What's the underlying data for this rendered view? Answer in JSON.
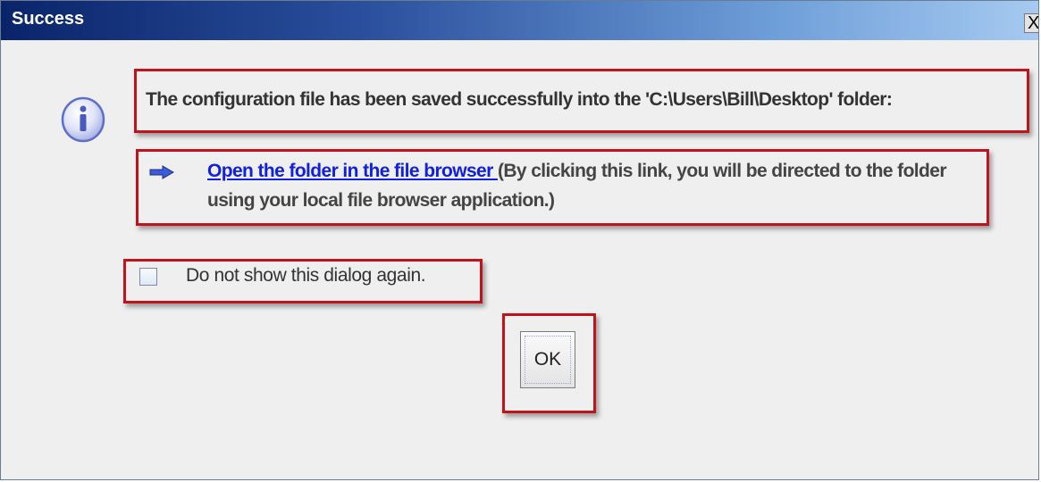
{
  "window": {
    "title": "Success",
    "close_label": "X"
  },
  "message": {
    "text": "The configuration file has been saved successfully into the 'C:\\Users\\Bill\\Desktop' folder:"
  },
  "link": {
    "label": "Open the folder in the file browser ",
    "description": "(By clicking this link, you will be directed to the folder using your local file browser application.)"
  },
  "checkbox": {
    "label": "Do not show this dialog again.",
    "checked": false
  },
  "buttons": {
    "ok_label": "OK"
  },
  "icons": {
    "info": "info-icon",
    "arrow": "arrow-right-icon"
  },
  "colors": {
    "highlight_border": "#c0141c",
    "link": "#1020e0",
    "titlebar_start": "#0a246a",
    "titlebar_end": "#a6caf0"
  }
}
